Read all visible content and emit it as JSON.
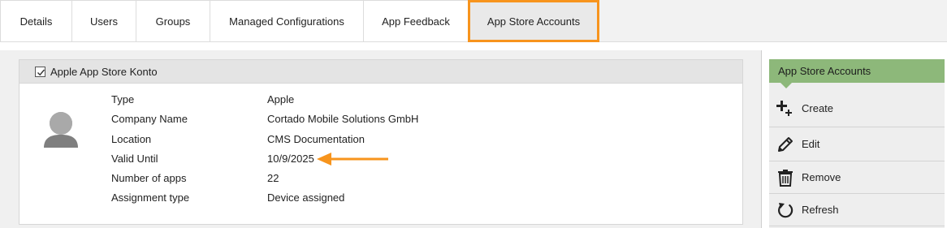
{
  "tabs": [
    {
      "label": "Details"
    },
    {
      "label": "Users"
    },
    {
      "label": "Groups"
    },
    {
      "label": "Managed Configurations"
    },
    {
      "label": "App Feedback"
    },
    {
      "label": "App Store Accounts",
      "active": true
    }
  ],
  "account": {
    "checked": true,
    "title": "Apple App Store Konto",
    "avatar_icon": "user-avatar-icon",
    "properties": [
      {
        "label": "Type",
        "value": "Apple"
      },
      {
        "label": "Company Name",
        "value": "Cortado Mobile Solutions GmbH"
      },
      {
        "label": "Location",
        "value": "CMS Documentation"
      },
      {
        "label": "Valid Until",
        "value": "10/9/2025"
      },
      {
        "label": "Number of apps",
        "value": "22"
      },
      {
        "label": "Assignment type",
        "value": "Device assigned"
      }
    ],
    "highlight_arrow_icon": "orange-arrow-icon"
  },
  "panel": {
    "title": "App Store Accounts",
    "actions": [
      {
        "label": "Create",
        "icon": "plus-icon"
      },
      {
        "label": "Edit",
        "icon": "pencil-icon"
      },
      {
        "label": "Remove",
        "icon": "trash-icon"
      },
      {
        "label": "Refresh",
        "icon": "refresh-icon"
      }
    ]
  },
  "colors": {
    "active_tab_border": "#f7941d",
    "panel_header": "#8db87a",
    "arrow": "#f7941d"
  }
}
